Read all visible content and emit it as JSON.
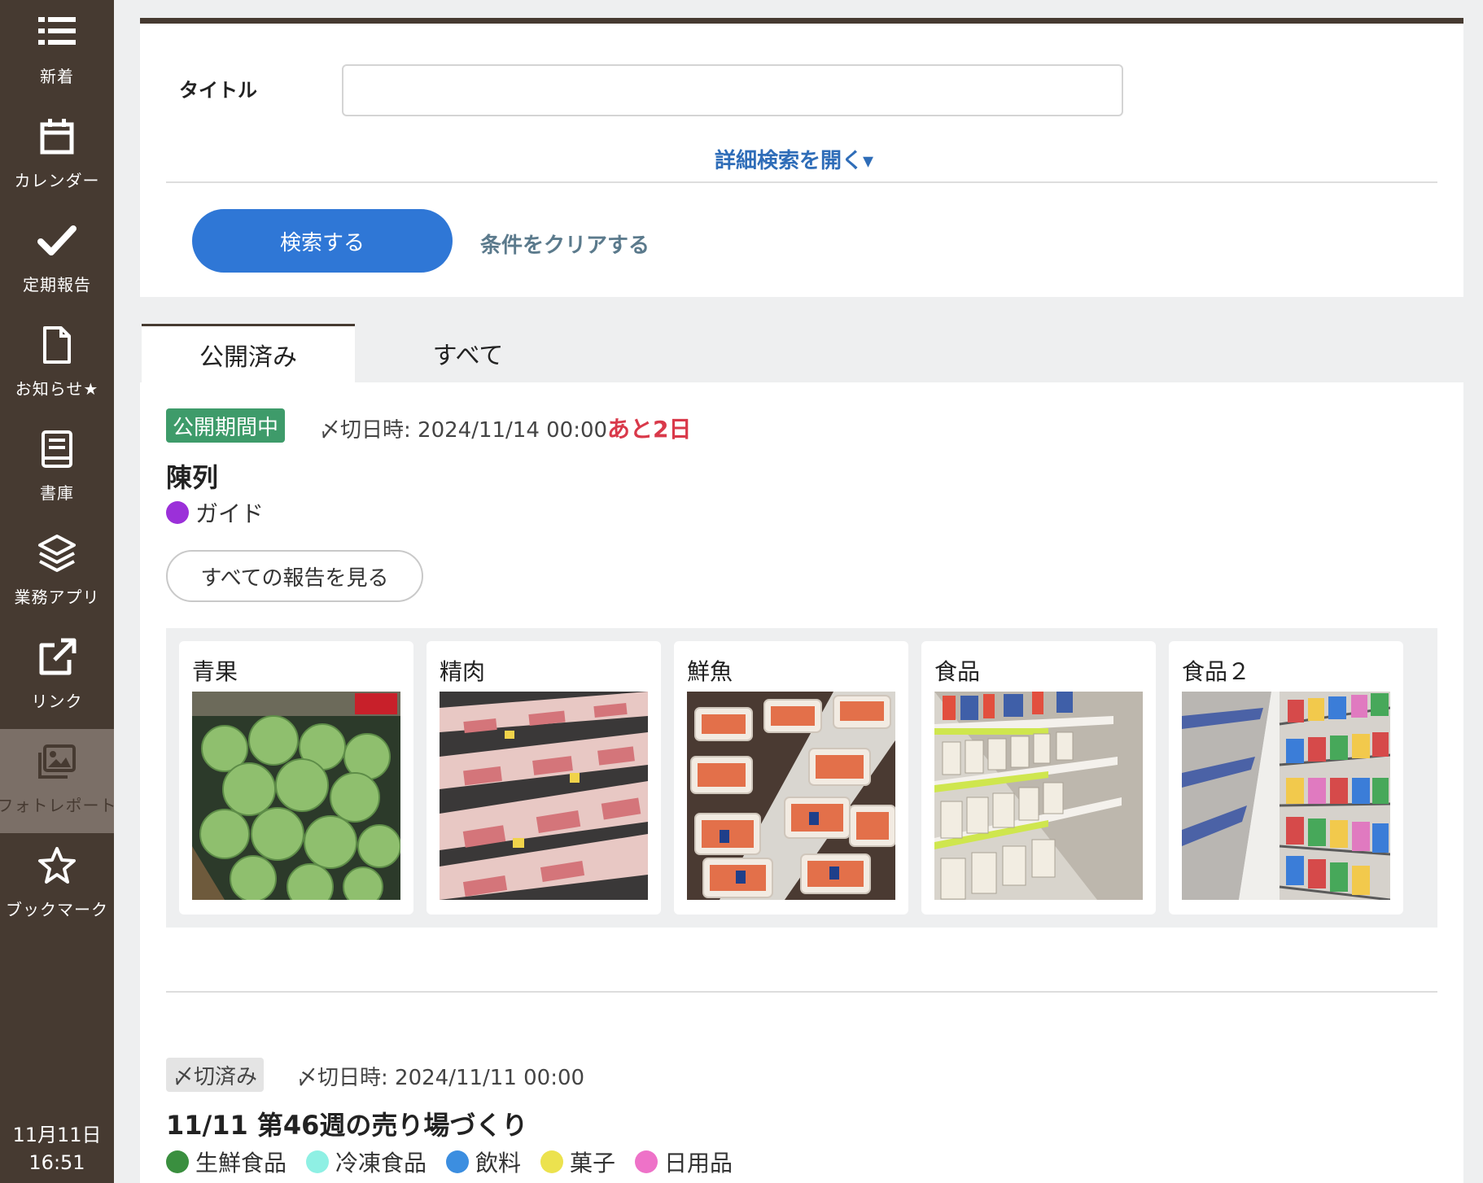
{
  "sidebar": {
    "items": [
      {
        "label": "新着",
        "icon": "list-icon"
      },
      {
        "label": "カレンダー",
        "icon": "calendar-icon"
      },
      {
        "label": "定期報告",
        "icon": "check-icon"
      },
      {
        "label": "お知らせ★",
        "icon": "document-icon"
      },
      {
        "label": "書庫",
        "icon": "book-icon"
      },
      {
        "label": "業務アプリ",
        "icon": "layers-icon"
      },
      {
        "label": "リンク",
        "icon": "external-link-icon"
      },
      {
        "label": "フォトレポート",
        "icon": "photos-icon"
      },
      {
        "label": "ブックマーク",
        "icon": "star-icon"
      }
    ],
    "active_item": "フォトレポート",
    "clock": {
      "date": "11月11日",
      "time": "16:51"
    }
  },
  "search": {
    "title_label": "タイトル",
    "title_value": "",
    "advanced_link": "詳細検索を開く▾",
    "search_button": "検索する",
    "clear_link": "条件をクリアする"
  },
  "tabs": {
    "published": "公開済み",
    "all": "すべて"
  },
  "reports": [
    {
      "status": "公開期間中",
      "deadline": "〆切日時: 2024/11/14 00:00",
      "remaining": "あと2日",
      "title": "陳列",
      "categories": [
        {
          "name": "ガイド",
          "color": "#9b30d9"
        }
      ],
      "all_reports_button": "すべての報告を見る",
      "photos": [
        {
          "title": "青果",
          "icon": "cabbage-photo"
        },
        {
          "title": "精肉",
          "icon": "meat-photo"
        },
        {
          "title": "鮮魚",
          "icon": "fish-photo"
        },
        {
          "title": "食品",
          "icon": "food-shelf-photo"
        },
        {
          "title": "食品２",
          "icon": "aisle-photo"
        }
      ]
    },
    {
      "status": "〆切済み",
      "deadline": "〆切日時: 2024/11/11 00:00",
      "title": "11/11 第46週の売り場づくり",
      "categories": [
        {
          "name": "生鮮食品",
          "color": "#3a8f3f"
        },
        {
          "name": "冷凍食品",
          "color": "#8ff0e4"
        },
        {
          "name": "飲料",
          "color": "#3c8ee0"
        },
        {
          "name": "菓子",
          "color": "#ece24e"
        },
        {
          "name": "日用品",
          "color": "#ee72c8"
        }
      ]
    }
  ],
  "colors": {
    "sidebar_bg": "#463a31",
    "primary_button": "#2f77d6",
    "link": "#2f6db8",
    "active_badge": "#3e9b6a",
    "remaining_text": "#d9394a"
  }
}
